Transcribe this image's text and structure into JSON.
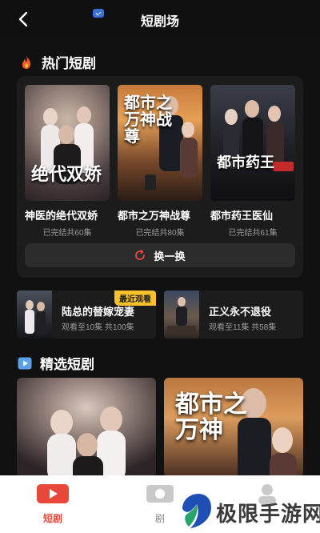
{
  "header": {
    "title": "短剧场"
  },
  "hot_section": {
    "title": "热门短剧",
    "cards": [
      {
        "poster_text": "绝代双娇",
        "title": "神医的绝代双娇",
        "meta": "已完结共60集"
      },
      {
        "poster_text": "都市之万神战尊",
        "title": "都市之万神战尊",
        "meta": "已完结共80集"
      },
      {
        "poster_text": "都市药王",
        "title": "都市药王医仙",
        "meta": "已完结共61集"
      }
    ],
    "swap_label": "换一换"
  },
  "recent": [
    {
      "title": "陆总的替嫁宠妻",
      "meta": "观看至10集 共100集",
      "badge": "最近观看"
    },
    {
      "title": "正义永不退役",
      "meta": "观看至11集 共58集"
    }
  ],
  "featured_section": {
    "title": "精选短剧",
    "items": [
      {
        "poster_text": ""
      },
      {
        "poster_text": "都市之万神"
      }
    ]
  },
  "tabbar": {
    "tabs": [
      {
        "label": "短剧",
        "active": true
      },
      {
        "label": "剧",
        "active": false
      },
      {
        "label": "",
        "active": false
      }
    ]
  },
  "watermark": {
    "text": "极限手游网"
  },
  "colors": {
    "accent": "#e8483c",
    "badge": "#f7c12b",
    "panel": "#1c1c1c",
    "background": "#111111"
  }
}
